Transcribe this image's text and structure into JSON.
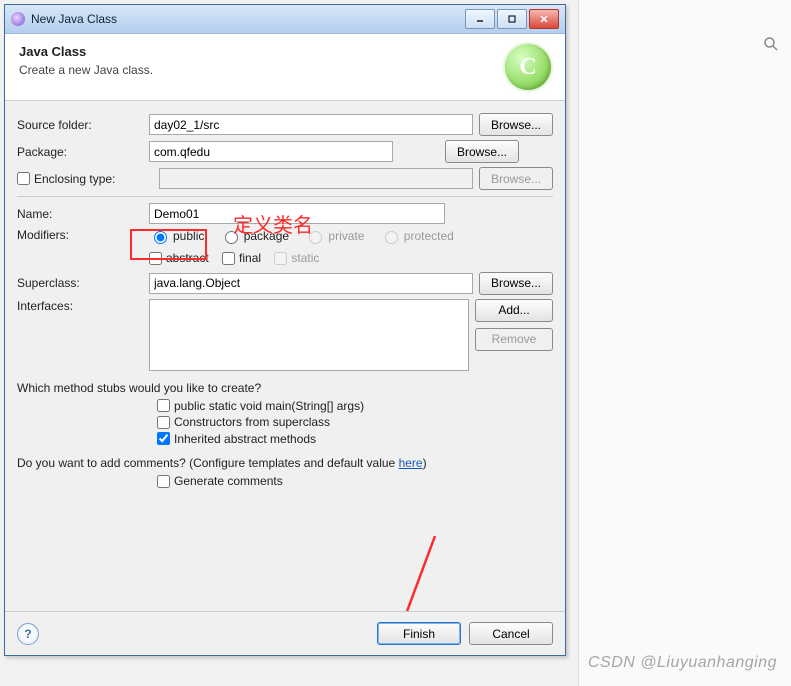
{
  "titlebar": {
    "title": "New Java Class"
  },
  "header": {
    "title": "Java Class",
    "subtitle": "Create a new Java class.",
    "icon_letter": "C"
  },
  "form": {
    "source_folder_label": "Source folder:",
    "source_folder_value": "day02_1/src",
    "package_label": "Package:",
    "package_value": "com.qfedu",
    "enclosing_type_label": "Enclosing type:",
    "enclosing_type_value": "",
    "name_label": "Name:",
    "name_value": "Demo01",
    "modifiers_label": "Modifiers:",
    "modifiers": {
      "public": "public",
      "package": "package",
      "private": "private",
      "protected": "protected",
      "abstract": "abstract",
      "final": "final",
      "static": "static"
    },
    "superclass_label": "Superclass:",
    "superclass_value": "java.lang.Object",
    "interfaces_label": "Interfaces:",
    "stubs_question": "Which method stubs would you like to create?",
    "stub_main": "public static void main(String[] args)",
    "stub_ctors": "Constructors from superclass",
    "stub_inherited": "Inherited abstract methods",
    "comments_question_prefix": "Do you want to add comments? (Configure templates and default value ",
    "comments_here": "here",
    "comments_question_suffix": ")",
    "generate_comments": "Generate comments"
  },
  "buttons": {
    "browse": "Browse...",
    "add": "Add...",
    "remove": "Remove",
    "finish": "Finish",
    "cancel": "Cancel"
  },
  "annotation": {
    "red_text": "定义类名"
  },
  "watermark": "CSDN @Liuyuanhanging"
}
